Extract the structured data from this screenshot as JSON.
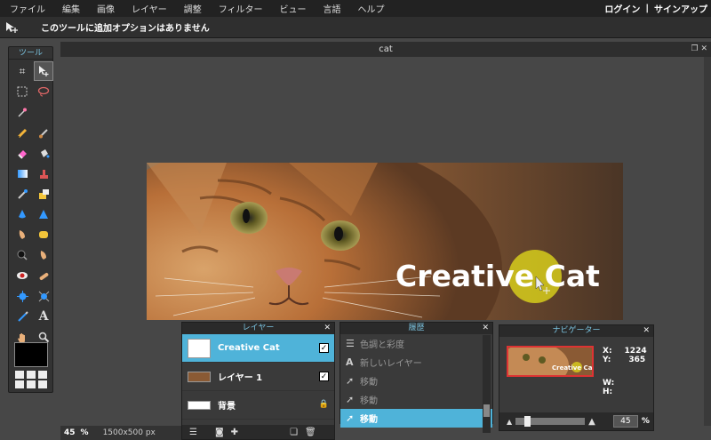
{
  "menu": {
    "items": [
      "ファイル",
      "編集",
      "画像",
      "レイヤー",
      "調整",
      "フィルター",
      "ビュー",
      "言語",
      "ヘルプ"
    ],
    "login": "ログイン",
    "separator": "|",
    "signup": "サインアップ"
  },
  "options": {
    "message": "このツールに追加オプションはありません"
  },
  "toolbox": {
    "title": "ツール"
  },
  "document": {
    "title": "cat",
    "zoom": "45",
    "zoom_unit": "%",
    "size": "1500x500 px",
    "overlay_text": "Creative Cat"
  },
  "layers": {
    "title": "レイヤー",
    "items": [
      {
        "name": "Creative Cat",
        "checked": true,
        "active": true
      },
      {
        "name": "レイヤー 1",
        "checked": true,
        "active": false
      },
      {
        "name": "背景",
        "locked": true,
        "active": false
      }
    ]
  },
  "history": {
    "title": "履歴",
    "items": [
      "色調と彩度",
      "新しいレイヤー",
      "移動",
      "移動",
      "移動"
    ]
  },
  "navigator": {
    "title": "ナビゲーター",
    "x_label": "X:",
    "x_value": "1224",
    "y_label": "Y:",
    "y_value": "365",
    "w_label": "W:",
    "h_label": "H:",
    "zoom": "45",
    "zoom_unit": "%",
    "thumb_text": "Creative Cat"
  },
  "colors": {
    "accent": "#4fb3d9",
    "highlight": "#e6df1a"
  }
}
